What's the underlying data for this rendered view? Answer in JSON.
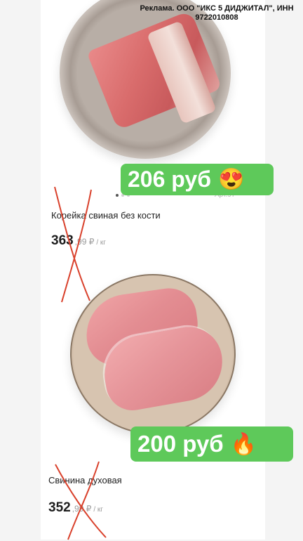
{
  "ad": {
    "text": "Реклама. ООО \"ИКС 5 ДИДЖИТАЛ\", ИНН 9722010808"
  },
  "products": [
    {
      "name": "Корейка свиная без кости",
      "old_price_int": "363",
      "old_price_frac": ",99 ₽",
      "unit": "/ кг",
      "promo_price": "206 руб",
      "promo_emoji": "😍",
      "art_code": "Арт.97"
    },
    {
      "name": "Свинина духовая",
      "old_price_int": "352",
      "old_price_frac": ",99 ₽",
      "unit": "/ кг",
      "promo_price": "200 руб",
      "promo_emoji": "🔥"
    }
  ],
  "colors": {
    "badge": "#5ec95a",
    "cross": "#d9412c"
  }
}
